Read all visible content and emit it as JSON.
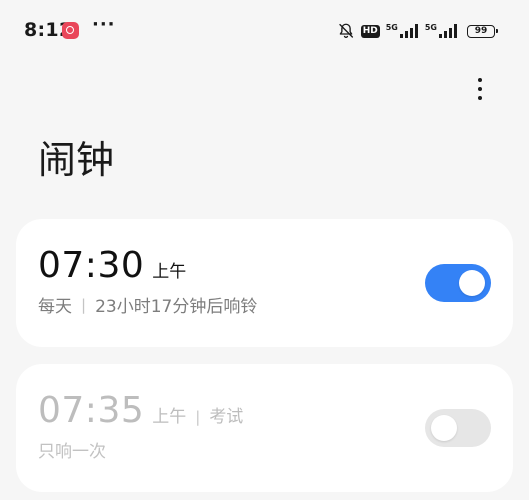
{
  "status_bar": {
    "time": "8:12",
    "app_notification_icon": "netease-music-icon",
    "more_notifications": "···",
    "icons": [
      "mute-bell-icon",
      "hd-icon",
      "5g-signal-icon",
      "5g-signal-icon",
      "battery-icon"
    ],
    "hd_label": "HD",
    "network_1": "5G",
    "network_2": "5G",
    "battery_level": "99"
  },
  "header": {
    "title": "闹钟",
    "menu_icon": "more-vertical-icon"
  },
  "alarms": [
    {
      "time": "07:30",
      "period": "上午",
      "label": "",
      "repeat": "每天",
      "separator": "|",
      "countdown": "23小时17分钟后响铃",
      "enabled": true
    },
    {
      "time": "07:35",
      "period": "上午",
      "label_separator": "|",
      "label": "考试",
      "repeat": "只响一次",
      "enabled": false
    }
  ],
  "colors": {
    "accent": "#3482f6",
    "background": "#f6f6f6",
    "card": "#ffffff",
    "toggle_off": "#e6e6e6",
    "notif_icon": "#e9465a"
  }
}
